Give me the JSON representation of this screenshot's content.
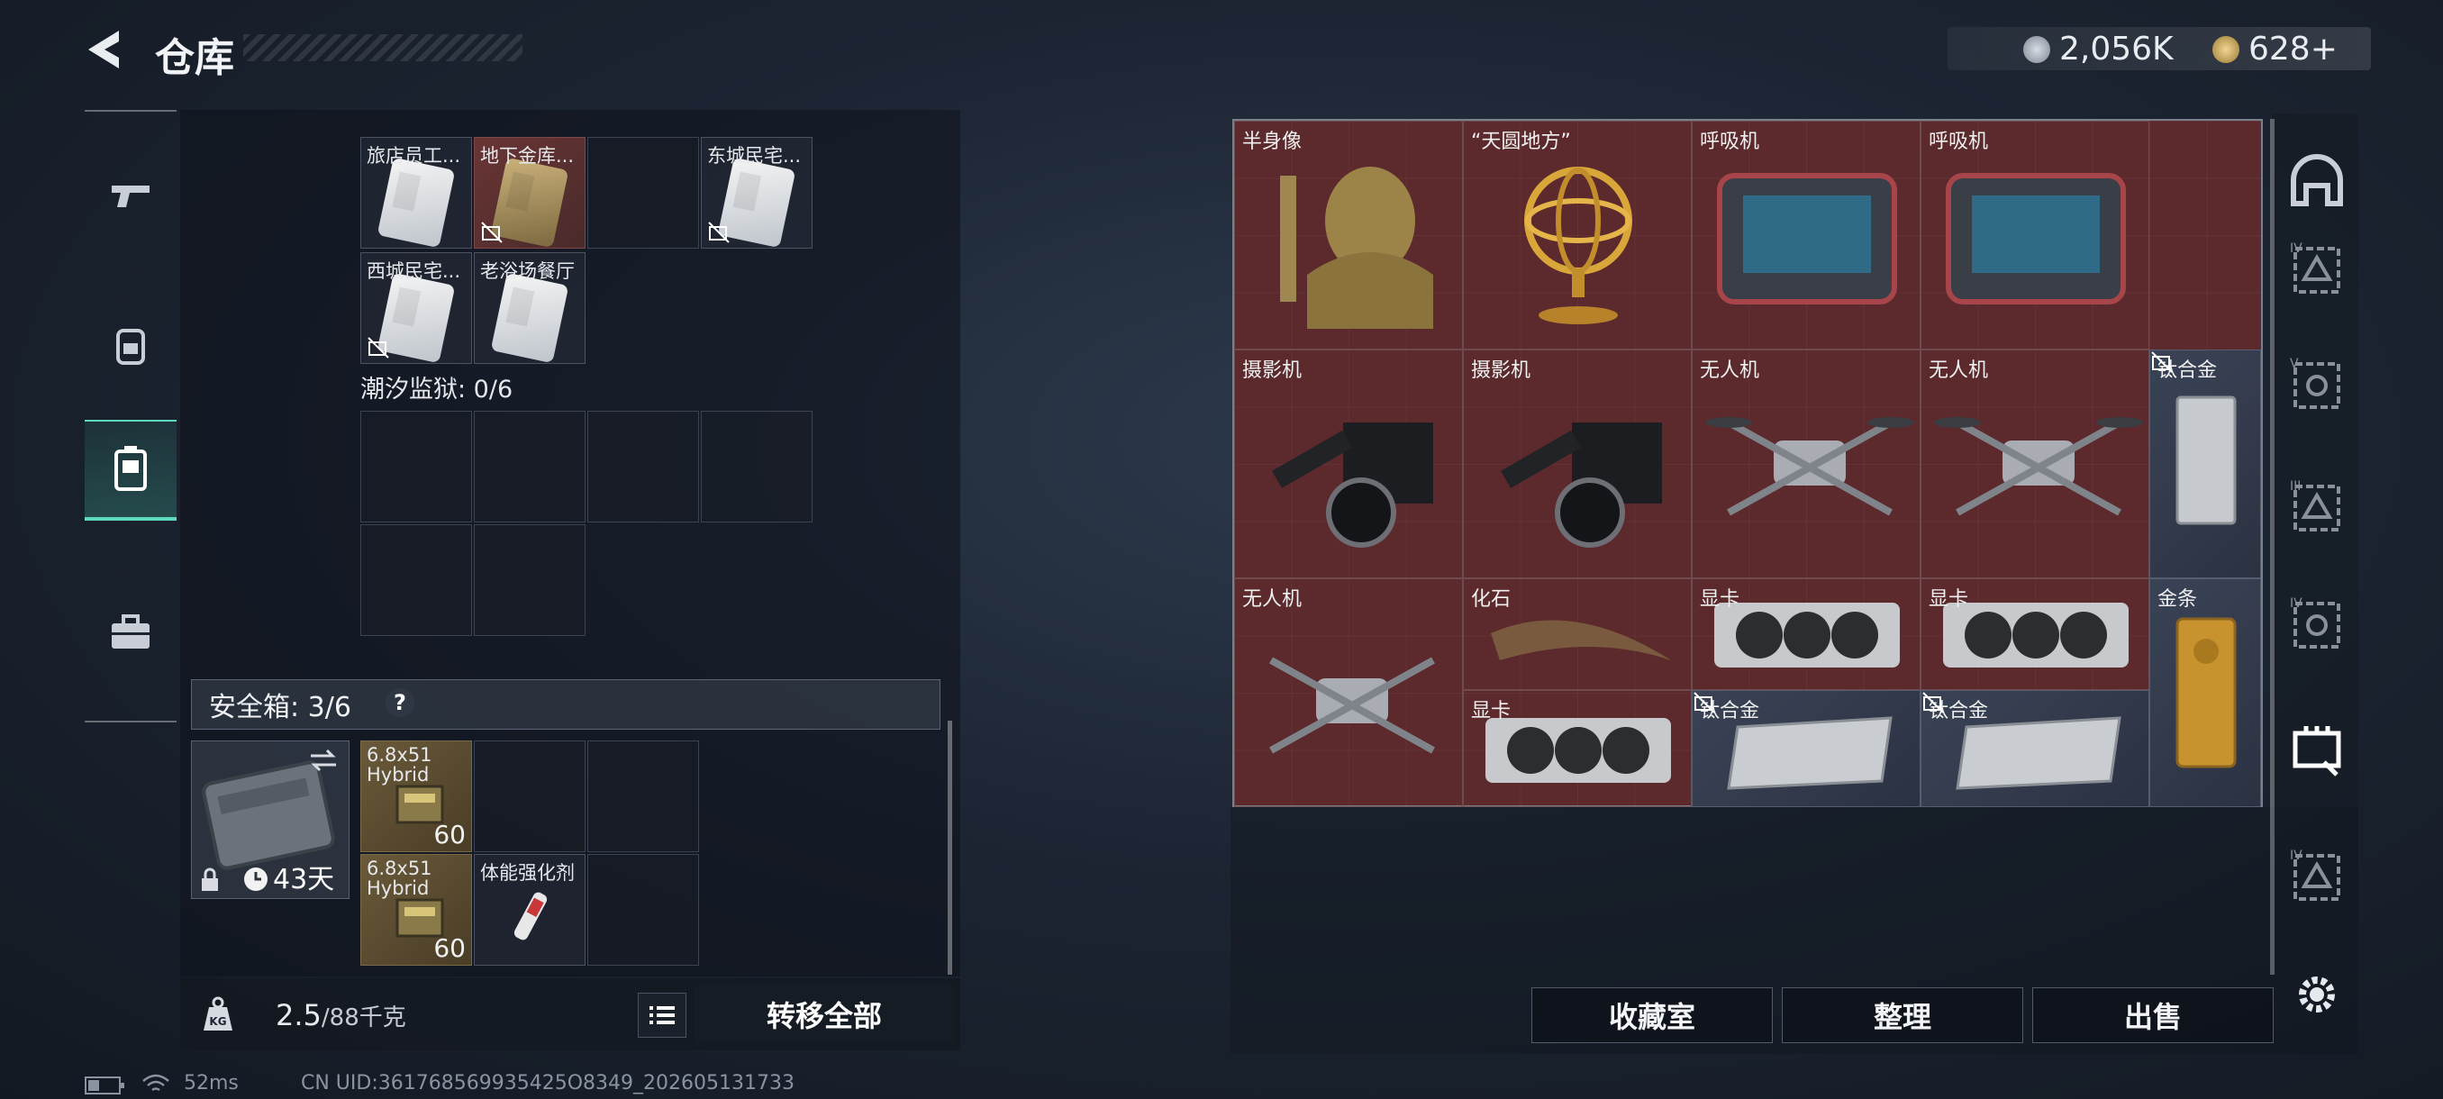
{
  "header": {
    "title": "仓库",
    "currency_silver": "2,056K",
    "currency_gold": "628+"
  },
  "left_nav": {
    "items": [
      "gun-icon",
      "backpack-icon",
      "storage-box-icon",
      "briefcase-icon"
    ],
    "active_index": 2
  },
  "key_section": {
    "row1": [
      {
        "label": "旅店员工...",
        "locked": false,
        "color": "white"
      },
      {
        "label": "地下金库...",
        "locked": true,
        "color": "gold"
      },
      {
        "label": "",
        "locked": false,
        "color": "empty"
      },
      {
        "label": "东城民宅...",
        "locked": true,
        "color": "white"
      }
    ],
    "row2": [
      {
        "label": "西城民宅...",
        "locked": true,
        "color": "white"
      },
      {
        "label": "老浴场餐厅",
        "locked": false,
        "color": "white"
      }
    ],
    "tidal_prison_label": "潮汐监狱: 0/6"
  },
  "secure_box": {
    "label": "安全箱: 3/6",
    "help": "?",
    "case_timer": "43天",
    "items": [
      {
        "label": "6.8x51 Hybrid",
        "qty": "60"
      },
      {
        "label": "6.8x51 Hybrid",
        "qty": "60"
      },
      {
        "label": "体能强化剂",
        "qty": ""
      }
    ]
  },
  "bottom_bar": {
    "weight": "2.5",
    "weight_max": "/88千克",
    "transfer_all": "转移全部"
  },
  "stash_items": [
    {
      "label": "半身像"
    },
    {
      "label": "“天圆地方”"
    },
    {
      "label": "呼吸机"
    },
    {
      "label": "呼吸机"
    },
    {
      "label": "摄影机"
    },
    {
      "label": "摄影机"
    },
    {
      "label": "无人机"
    },
    {
      "label": "无人机"
    },
    {
      "label": "钛合金"
    },
    {
      "label": "无人机"
    },
    {
      "label": "化石"
    },
    {
      "label": "显卡"
    },
    {
      "label": "显卡"
    },
    {
      "label": "金条"
    },
    {
      "label": "显卡"
    },
    {
      "label": "钛合金"
    },
    {
      "label": "钛合金"
    }
  ],
  "right_nav": {
    "labels": [
      "",
      "IV",
      "V",
      "III",
      "IV",
      "",
      "IV"
    ]
  },
  "actions": {
    "collection": "收藏室",
    "organize": "整理",
    "sell": "出售"
  },
  "status": {
    "ping": "52ms",
    "uid": "CN UID:361768569935425O8349_202605131733"
  }
}
